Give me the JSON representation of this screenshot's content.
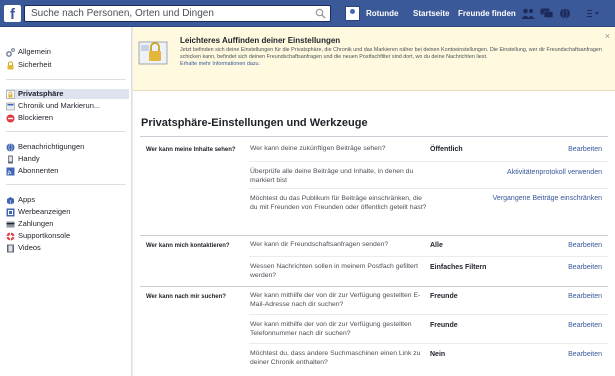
{
  "topbar": {
    "logo": "f",
    "search_placeholder": "Suche nach Personen, Orten und Dingen",
    "nav": [
      "Rotunde",
      "Startseite",
      "Freunde finden"
    ]
  },
  "sidebar": {
    "group1": [
      {
        "label": "Allgemein",
        "icon": "gear-icon"
      },
      {
        "label": "Sicherheit",
        "icon": "lock-icon"
      }
    ],
    "group2": [
      {
        "label": "Privatsphäre",
        "icon": "privacy-lock-icon",
        "active": true
      },
      {
        "label": "Chronik und Markierun...",
        "icon": "timeline-icon"
      },
      {
        "label": "Blockieren",
        "icon": "block-icon"
      }
    ],
    "group3": [
      {
        "label": "Benachrichtigungen",
        "icon": "globe-icon"
      },
      {
        "label": "Handy",
        "icon": "mobile-icon"
      },
      {
        "label": "Abonnenten",
        "icon": "rss-icon"
      }
    ],
    "group4": [
      {
        "label": "Apps",
        "icon": "apps-icon"
      },
      {
        "label": "Werbeanzeigen",
        "icon": "ads-icon"
      },
      {
        "label": "Zahlungen",
        "icon": "card-icon"
      },
      {
        "label": "Supportkonsole",
        "icon": "lifebuoy-icon"
      },
      {
        "label": "Videos",
        "icon": "film-icon"
      }
    ]
  },
  "notice": {
    "title": "Leichteres Auffinden deiner Einstellungen",
    "body": "Jetzt befinden sich deine Einstellungen für die Privatsphäre, die Chronik und das Markieren näher bei deinen Kontoeinstellungen. Die Einstellung, wer dir Freundschaftsanfragen schicken kann, befindet sich deinen Freundschaftsanfragen und die neuen Postfachfilter sind dort, wo du deine Nachrichten liest.",
    "link": "Erhalte mehr Informationen dazu.",
    "close": "×"
  },
  "main": {
    "title": "Privatsphäre-Einstellungen und Werkzeuge",
    "sections": [
      {
        "category": "Wer kann meine Inhalte sehen?",
        "rows": [
          {
            "question": "Wer kann deine zukünftigen Beiträge sehen?",
            "value": "Öffentlich",
            "action": "Bearbeiten"
          },
          {
            "question": "Überprüfe alle deine Beiträge und Inhalte, in denen du markiert bist",
            "value": "",
            "action": "Aktivitätenprotokoll verwenden"
          },
          {
            "question": "Möchtest du das Publikum für Beiträge einschränken, die du mit Freunden von Freunden oder öffentlich geteilt hast?",
            "value": "",
            "action": "Vergangene Beiträge einschränken"
          }
        ]
      },
      {
        "category": "Wer kann mich kontaktieren?",
        "rows": [
          {
            "question": "Wer kann dir Freundschaftsanfragen senden?",
            "value": "Alle",
            "action": "Bearbeiten"
          },
          {
            "question": "Wessen Nachrichten sollen in meinem Postfach gefiltert werden?",
            "value": "Einfaches Filtern",
            "action": "Bearbeiten"
          }
        ]
      },
      {
        "category": "Wer kann nach mir suchen?",
        "rows": [
          {
            "question": "Wer kann mithilfe der von dir zur Verfügung gestellten E-Mail-Adresse nach dir suchen?",
            "value": "Freunde",
            "action": "Bearbeiten"
          },
          {
            "question": "Wer kann mithilfe der von dir zur Verfügung gestellten Telefonnummer nach dir suchen?",
            "value": "Freunde",
            "action": "Bearbeiten"
          },
          {
            "question": "Möchtest du, dass andere Suchmaschinen einen Link zu deiner Chronik enthalten?",
            "value": "Nein",
            "action": "Bearbeiten"
          }
        ]
      }
    ]
  },
  "colors": {
    "brand": "#3b5998",
    "link": "#365899",
    "notice_bg": "#fffadf"
  }
}
